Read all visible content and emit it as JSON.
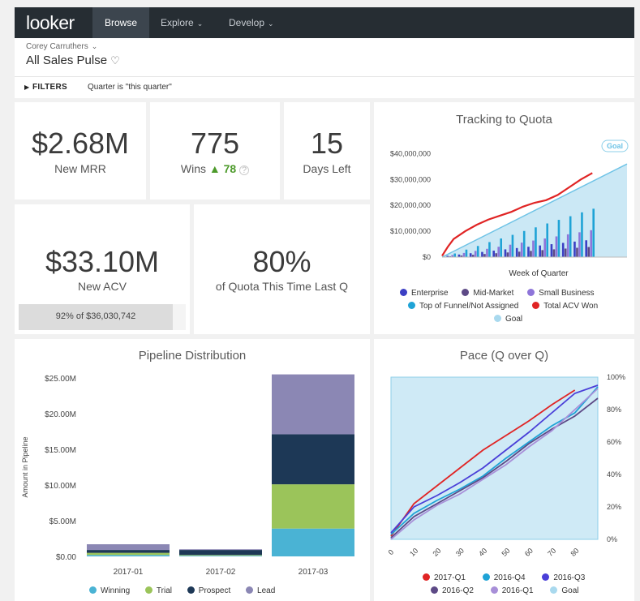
{
  "nav": {
    "logo": "looker",
    "items": [
      {
        "label": "Browse",
        "active": true
      },
      {
        "label": "Explore"
      },
      {
        "label": "Develop"
      }
    ]
  },
  "header": {
    "owner": "Corey Carruthers",
    "title": "All Sales Pulse"
  },
  "filters": {
    "label": "FILTERS",
    "value": "Quarter is \"this quarter\""
  },
  "kpis": {
    "mrr": {
      "value": "$2.68M",
      "label": "New MRR"
    },
    "wins": {
      "value": "775",
      "label": "Wins",
      "delta": "78"
    },
    "days": {
      "value": "15",
      "label": "Days Left"
    },
    "acv": {
      "value": "$33.10M",
      "label": "New ACV",
      "progress_pct": "92%",
      "progress_of": "of",
      "progress_total": "$36,030,742",
      "progress_fraction": 0.92
    },
    "quota": {
      "value": "80%",
      "label": "of Quota This Time Last Q"
    }
  },
  "colors": {
    "enterprise": "#3b3fc4",
    "mid_market": "#5d4a86",
    "small_business": "#8e75d9",
    "top_funnel": "#1fa3d6",
    "total_acv": "#e02424",
    "goal": "#a9d9ee",
    "winning": "#4ab3d4",
    "trial": "#9bc45a",
    "prospect": "#1d3856",
    "lead": "#8b87b4",
    "q2017_1": "#e02424",
    "q2016_4": "#1fa3d6",
    "q2016_3": "#4a3fd8",
    "q2016_2": "#5d4a86",
    "q2016_1": "#a88fd8",
    "pace_goal": "#a9d9ee"
  },
  "chart_data": [
    {
      "id": "tracking",
      "type": "bar",
      "title": "Tracking to Quota",
      "xlabel": "Week of Quarter",
      "ylabel": "",
      "ylim": [
        0,
        42000000
      ],
      "yticks": [
        "$40,000,000",
        "$30,000,000",
        "$20,000,000",
        "$10,000,000",
        "$0"
      ],
      "goal_label": "Goal",
      "weeks": 13,
      "series": [
        {
          "name": "Enterprise",
          "values": [
            500000,
            1000000,
            1500000,
            2000000,
            2500000,
            3000000,
            3500000,
            4000000,
            4500000,
            5000000,
            5500000,
            6000000,
            6500000
          ]
        },
        {
          "name": "Mid-Market",
          "values": [
            300000,
            600000,
            900000,
            1200000,
            1500000,
            1800000,
            2100000,
            2400000,
            2700000,
            3000000,
            3300000,
            3600000,
            3900000
          ]
        },
        {
          "name": "Small Business",
          "values": [
            800000,
            1600000,
            2400000,
            3200000,
            4000000,
            4800000,
            5600000,
            6400000,
            7200000,
            8000000,
            8800000,
            9600000,
            10400000
          ]
        },
        {
          "name": "Top of Funnel/Not Assigned",
          "values": [
            1400000,
            2900000,
            4300000,
            5800000,
            7200000,
            8600000,
            10100000,
            11500000,
            13000000,
            14400000,
            15800000,
            17300000,
            18700000
          ]
        },
        {
          "name": "Total ACV Won",
          "type": "line",
          "x": [
            0,
            0.5,
            1,
            2,
            3,
            4,
            5,
            6,
            7,
            8,
            9,
            10,
            11,
            12,
            13
          ],
          "values": [
            500000,
            4000000,
            7000000,
            10000000,
            12500000,
            14500000,
            16000000,
            17500000,
            19500000,
            21000000,
            22000000,
            24000000,
            27000000,
            30000000,
            32500000
          ]
        },
        {
          "name": "Goal",
          "type": "area",
          "x": [
            0,
            16
          ],
          "values": [
            0,
            36000000
          ]
        }
      ],
      "legend": [
        "Enterprise",
        "Mid-Market",
        "Small Business",
        "Top of Funnel/Not Assigned",
        "Total ACV Won",
        "Goal"
      ]
    },
    {
      "id": "pipeline",
      "type": "bar",
      "title": "Pipeline Distribution",
      "xlabel": "",
      "ylabel": "Amount in Pipeline",
      "ylim": [
        0,
        25000000
      ],
      "yticks": [
        "$25.00M",
        "$20.00M",
        "$15.00M",
        "$10.00M",
        "$5.00M",
        "$0.00"
      ],
      "categories": [
        "2017-01",
        "2017-02",
        "2017-03"
      ],
      "series": [
        {
          "name": "Winning",
          "values": [
            200000,
            100000,
            3900000
          ]
        },
        {
          "name": "Trial",
          "values": [
            300000,
            100000,
            6200000
          ]
        },
        {
          "name": "Prospect",
          "values": [
            400000,
            700000,
            7000000
          ]
        },
        {
          "name": "Lead",
          "values": [
            800000,
            100000,
            8400000
          ]
        }
      ]
    },
    {
      "id": "pace",
      "type": "line",
      "title": "Pace (Q over Q)",
      "xlabel": "",
      "ylabel": "",
      "xlim": [
        0,
        90
      ],
      "ylim": [
        0,
        100
      ],
      "xticks": [
        "0",
        "10",
        "20",
        "30",
        "40",
        "50",
        "60",
        "70",
        "80"
      ],
      "yticks": [
        "100%",
        "80%",
        "60%",
        "40%",
        "20%",
        "0%"
      ],
      "x": [
        0,
        10,
        20,
        30,
        40,
        50,
        60,
        70,
        80,
        90
      ],
      "series": [
        {
          "name": "2017-Q1",
          "values": [
            2,
            22,
            33,
            44,
            55,
            64,
            73,
            83,
            92,
            null
          ]
        },
        {
          "name": "2016-Q4",
          "values": [
            3,
            16,
            24,
            31,
            39,
            50,
            60,
            70,
            78,
            94
          ]
        },
        {
          "name": "2016-Q3",
          "values": [
            4,
            20,
            27,
            35,
            44,
            55,
            66,
            78,
            90,
            95
          ]
        },
        {
          "name": "2016-Q2",
          "values": [
            1,
            14,
            22,
            30,
            38,
            48,
            59,
            68,
            76,
            87
          ]
        },
        {
          "name": "2016-Q1",
          "values": [
            0,
            12,
            21,
            28,
            37,
            46,
            57,
            67,
            80,
            93
          ]
        },
        {
          "name": "Goal",
          "type": "area",
          "values": [
            100,
            100,
            100,
            100,
            100,
            100,
            100,
            100,
            100,
            100
          ]
        }
      ]
    }
  ]
}
